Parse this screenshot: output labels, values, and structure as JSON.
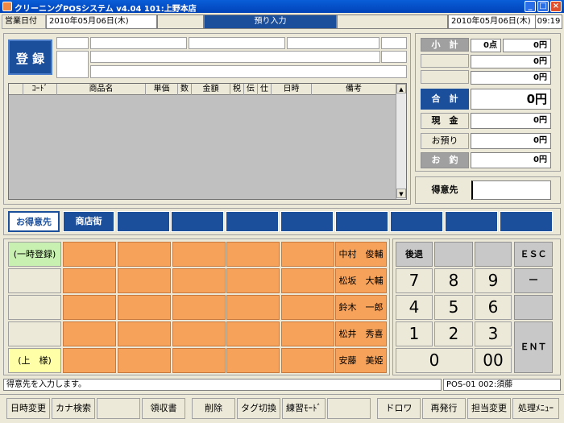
{
  "window": {
    "title": "クリーニングPOSシステム v4.04  101:上野本店",
    "min": "_",
    "max": "□",
    "close": "×"
  },
  "header": {
    "business_date_label": "営業日付",
    "business_date": "2010年05月06日(木)",
    "mode": "預り入力",
    "current_date": "2010年05月06日(木)",
    "time": "09:19"
  },
  "register": {
    "label": "登 録"
  },
  "table": {
    "columns": [
      "ｺｰﾄﾞ",
      "商品名",
      "単価",
      "数",
      "金額",
      "税",
      "伝",
      "仕",
      "日時",
      "備考"
    ],
    "rows": [],
    "scroll_up": "▲",
    "scroll_down": "▼"
  },
  "totals": {
    "subtotal_label": "小　計",
    "subtotal_count": "0点",
    "subtotal_amount": "0円",
    "row2_amount": "0円",
    "row3_amount": "0円",
    "total_label": "合　計",
    "total_amount": "0円",
    "cash_label": "現　金",
    "cash_amount": "0円",
    "deposit_label": "お預り",
    "deposit_amount": "0円",
    "change_label": "お　釣",
    "change_amount": "0円"
  },
  "customer": {
    "label": "得意先",
    "value": ""
  },
  "tabs": [
    "お得意先",
    "商店街",
    "",
    "",
    "",
    "",
    "",
    "",
    "",
    ""
  ],
  "side_buttons": [
    "(一時登録)",
    "",
    "",
    "",
    "(上　様)"
  ],
  "names": [
    "中村　俊輔",
    "松坂　大輔",
    "鈴木　一郎",
    "松井　秀喜",
    "安藤　美姫"
  ],
  "keypad": {
    "back": "後退",
    "esc": "ＥＳＣ",
    "minus": "－",
    "ent": "ＥＮＴ",
    "digits": [
      "7",
      "8",
      "9",
      "4",
      "5",
      "6",
      "1",
      "2",
      "3",
      "0",
      "00"
    ]
  },
  "status": {
    "message": "得意先を入力します。",
    "terminal": "POS-01 002:須藤"
  },
  "function_keys": [
    "日時変更",
    "カナ検索",
    "",
    "領収書",
    "",
    "削除",
    "タグ切換",
    "練習ﾓｰﾄﾞ",
    "",
    "",
    "ドロワ",
    "再発行",
    "担当変更",
    "処理ﾒﾆｭｰ"
  ]
}
